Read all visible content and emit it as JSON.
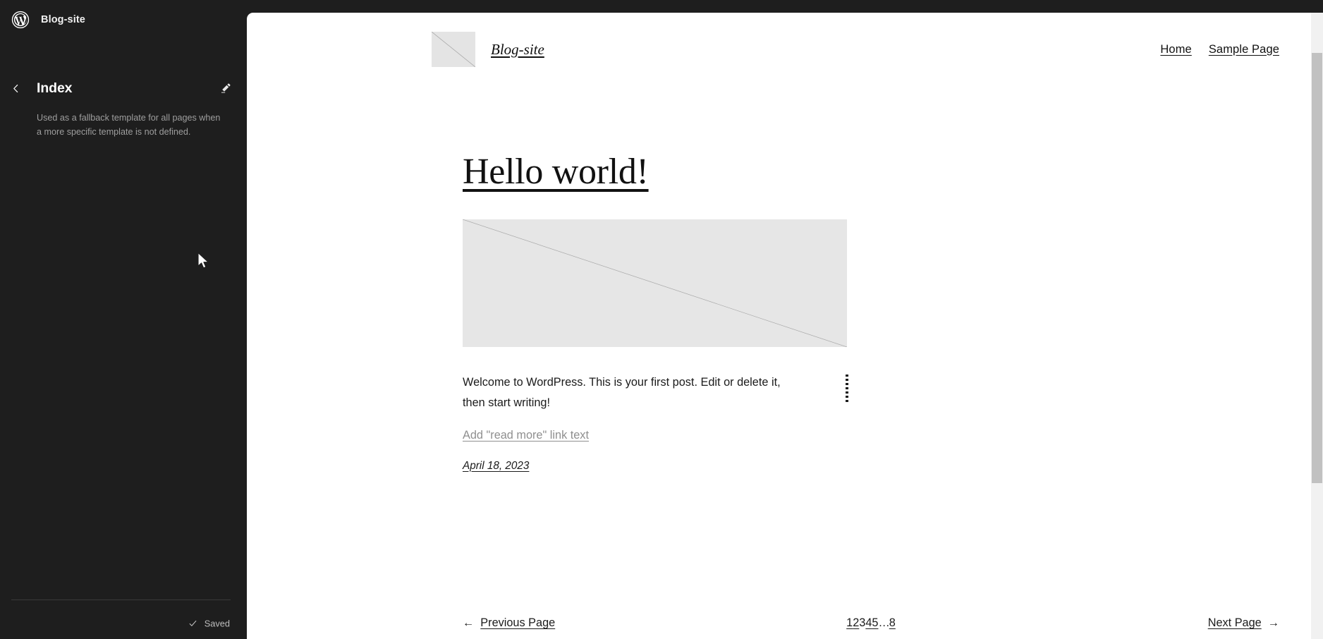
{
  "editor": {
    "site_title": "Blog-site",
    "wordpress_logo_icon": "wordpress-logo-icon",
    "back_icon": "chevron-left-icon",
    "edit_icon": "pencil-icon",
    "template": {
      "title": "Index",
      "description": "Used as a fallback template for all pages when a more specific template is not defined."
    },
    "save_status": {
      "label": "Saved",
      "icon": "check-icon"
    },
    "colors": {
      "sidebar_bg": "#1e1e1e",
      "canvas_bg": "#ffffff",
      "muted_text": "#9e9e9e",
      "scrollbar_thumb": "#c1c1c1"
    }
  },
  "site": {
    "header": {
      "logo_icon": "site-logo-placeholder-icon",
      "brand_label": "Blog-site",
      "nav_links": [
        {
          "label": "Home"
        },
        {
          "label": "Sample Page"
        }
      ]
    },
    "post": {
      "title": "Hello world!",
      "featured_image_icon": "image-placeholder-icon",
      "excerpt": "Welcome to WordPress. This is your first post. Edit or delete it, then start writing!",
      "read_more_label": "Add \"read more\" link text",
      "date": "April 18, 2023"
    },
    "pagination": {
      "previous": {
        "arrow": "←",
        "label": "Previous Page"
      },
      "next": {
        "arrow": "→",
        "label": "Next Page"
      },
      "pages": [
        {
          "label": "1",
          "current": false
        },
        {
          "label": "2",
          "current": false
        },
        {
          "label": "3",
          "current": true
        },
        {
          "label": "4",
          "current": false
        },
        {
          "label": "5",
          "current": false
        },
        {
          "label": "…",
          "current": false,
          "ellipsis": true
        },
        {
          "label": "8",
          "current": false
        }
      ]
    }
  }
}
